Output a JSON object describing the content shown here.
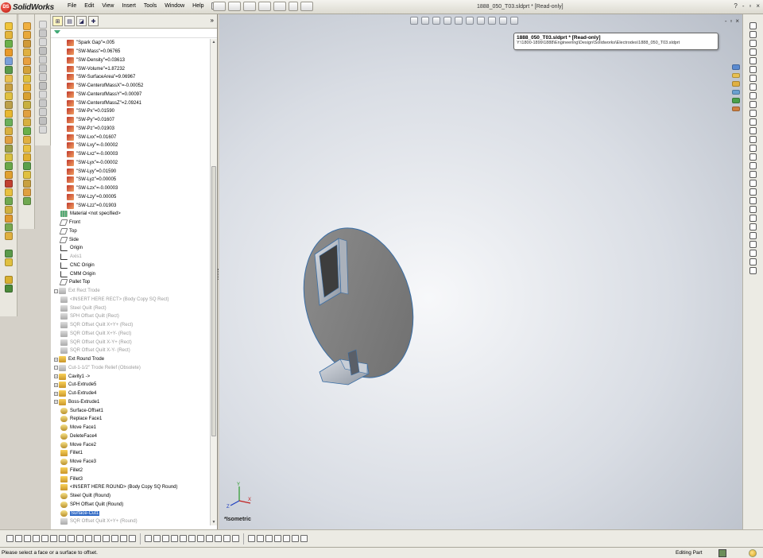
{
  "app": {
    "brand": "SolidWorks",
    "brand_mark": "DS",
    "document_title": "1888_050_T03.sldprt * [Read-only]",
    "help_glyph": "?",
    "minimize_glyph": "-",
    "restore_glyph": "▫",
    "close_glyph": "×"
  },
  "menu": [
    "File",
    "Edit",
    "View",
    "Insert",
    "Tools",
    "Window",
    "Help"
  ],
  "feature_manager": {
    "tabs": [
      "FeatureManager",
      "PropertyManager",
      "ConfigurationManager",
      "DimXpertManager"
    ],
    "more_glyph": "»",
    "items": [
      {
        "label": "\"Spark Gap\"=.005",
        "icon": "eq"
      },
      {
        "label": "\"SW-Mass\"=0.06765",
        "icon": "eq"
      },
      {
        "label": "\"SW-Density\"=0.03613",
        "icon": "eq"
      },
      {
        "label": "\"SW-Volume\"=1.87232",
        "icon": "eq"
      },
      {
        "label": "\"SW-SurfaceArea\"=9.06967",
        "icon": "eq"
      },
      {
        "label": "\"SW-CenterofMassX\"=-0.00052",
        "icon": "eq"
      },
      {
        "label": "\"SW-CenterofMassY\"=0.00097",
        "icon": "eq"
      },
      {
        "label": "\"SW-CenterofMassZ\"=2.09241",
        "icon": "eq"
      },
      {
        "label": "\"SW-Px\"=0.01590",
        "icon": "eq"
      },
      {
        "label": "\"SW-Py\"=0.01607",
        "icon": "eq"
      },
      {
        "label": "\"SW-Pz\"=0.01903",
        "icon": "eq"
      },
      {
        "label": "\"SW-Lxx\"=0.01607",
        "icon": "eq"
      },
      {
        "label": "\"SW-Lxy\"=-0.00002",
        "icon": "eq"
      },
      {
        "label": "\"SW-Lxz\"=-0.00003",
        "icon": "eq"
      },
      {
        "label": "\"SW-Lyx\"=-0.00002",
        "icon": "eq"
      },
      {
        "label": "\"SW-Lyy\"=0.01590",
        "icon": "eq"
      },
      {
        "label": "\"SW-Lyz\"=0.00005",
        "icon": "eq"
      },
      {
        "label": "\"SW-Lzx\"=-0.00003",
        "icon": "eq"
      },
      {
        "label": "\"SW-Lzy\"=0.00005",
        "icon": "eq"
      },
      {
        "label": "\"SW-Lzz\"=0.01903",
        "icon": "eq"
      },
      {
        "label": "Material <not specified>",
        "icon": "mat",
        "indent": 1
      },
      {
        "label": "Front",
        "icon": "plane",
        "indent": 1
      },
      {
        "label": "Top",
        "icon": "plane",
        "indent": 1
      },
      {
        "label": "Side",
        "icon": "plane",
        "indent": 1
      },
      {
        "label": "Origin",
        "icon": "org",
        "indent": 1
      },
      {
        "label": "Axis1",
        "icon": "org",
        "indent": 1,
        "dim": true
      },
      {
        "label": "CNC Origin",
        "icon": "org",
        "indent": 1
      },
      {
        "label": "CMM Origin",
        "icon": "org",
        "indent": 1
      },
      {
        "label": "Pallet Top",
        "icon": "plane",
        "indent": 1
      },
      {
        "label": "Ext Rect Trode",
        "icon": "gray",
        "indent": 0,
        "expander": true,
        "dim": true
      },
      {
        "label": "<INSERT HERE RECT> (Body Copy SQ Rect)",
        "icon": "gray",
        "indent": 1,
        "dim": true
      },
      {
        "label": "Steel Quilt (Rect)",
        "icon": "gray",
        "indent": 1,
        "dim": true
      },
      {
        "label": "SPH Offset Quilt (Rect)",
        "icon": "gray",
        "indent": 1,
        "dim": true
      },
      {
        "label": "SQR Offset Quilt X+Y+ (Rect)",
        "icon": "gray",
        "indent": 1,
        "dim": true
      },
      {
        "label": "SQR Offset Quilt X+Y- (Rect)",
        "icon": "gray",
        "indent": 1,
        "dim": true
      },
      {
        "label": "SQR Offset Quilt X-Y+ (Rect)",
        "icon": "gray",
        "indent": 1,
        "dim": true
      },
      {
        "label": "SQR Offset Quilt X-Y- (Rect)",
        "icon": "gray",
        "indent": 1,
        "dim": true
      },
      {
        "label": "Ext Round Trode",
        "icon": "feat",
        "indent": 0,
        "expander": true
      },
      {
        "label": "Cut-1-1/2\" Trode Relief (Obsolete)",
        "icon": "gray",
        "indent": 0,
        "expander": true,
        "dim": true
      },
      {
        "label": "Cavity1 ->",
        "icon": "feat",
        "indent": 0,
        "expander": true
      },
      {
        "label": "Cut-Extrude5",
        "icon": "feat",
        "indent": 0,
        "expander": true
      },
      {
        "label": "Cut-Extrude4",
        "icon": "feat",
        "indent": 0,
        "expander": true
      },
      {
        "label": "Boss-Extrude1",
        "icon": "feat",
        "indent": 0,
        "expander": true
      },
      {
        "label": "Surface-Offset1",
        "icon": "srf",
        "indent": 1
      },
      {
        "label": "Replace Face1",
        "icon": "srf",
        "indent": 1
      },
      {
        "label": "Move Face1",
        "icon": "srf",
        "indent": 1
      },
      {
        "label": "DeleteFace4",
        "icon": "srf",
        "indent": 1
      },
      {
        "label": "Move Face2",
        "icon": "srf",
        "indent": 1
      },
      {
        "label": "Fillet1",
        "icon": "feat",
        "indent": 1
      },
      {
        "label": "Move Face3",
        "icon": "srf",
        "indent": 1
      },
      {
        "label": "Fillet2",
        "icon": "feat",
        "indent": 1
      },
      {
        "label": "Fillet3",
        "icon": "feat",
        "indent": 1
      },
      {
        "label": "<INSERT HERE ROUND> (Body Copy SQ Round)",
        "icon": "feat",
        "indent": 1
      },
      {
        "label": "Steel Quilt (Round)",
        "icon": "srf",
        "indent": 1
      },
      {
        "label": "SPH Offset Quilt (Round)",
        "icon": "srf",
        "indent": 1
      },
      {
        "label": "Surface-Cut1",
        "icon": "srf",
        "indent": 1,
        "selected": true
      },
      {
        "label": "SQR Offset Quilt X+Y+ (Round)",
        "icon": "gray",
        "indent": 1,
        "dim": true
      }
    ]
  },
  "tooltip": {
    "title": "1888_050_T03.sldprt * [Read-only]",
    "path": "Y:\\1800-1899\\1888\\Engineering\\Design\\Solidworks\\Electrodes\\1888_050_T03.sldprt"
  },
  "viewport": {
    "view_name": "*Isometric",
    "triad_x": "X",
    "triad_y": "Y",
    "triad_z": "Z"
  },
  "status": {
    "message": "Please select a face or a surface to offset.",
    "mode": "Editing Part"
  }
}
